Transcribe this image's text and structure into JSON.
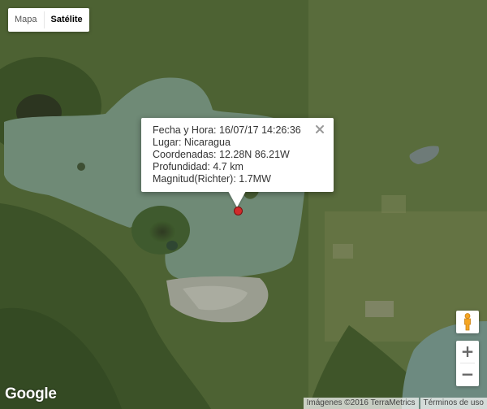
{
  "map_type": {
    "options": [
      "Mapa",
      "Satélite"
    ],
    "selected": "Satélite"
  },
  "info_window": {
    "lines": [
      "Fecha y Hora: 16/07/17 14:26:36",
      "Lugar: Nicaragua",
      "Coordenadas: 12.28N 86.21W",
      "Profundidad: 4.7 km",
      "Magnitud(Richter): 1.7MW"
    ],
    "close_icon": "close-icon"
  },
  "marker": {
    "color": "#d12a2a",
    "icon": "earthquake-marker"
  },
  "controls": {
    "pegman_icon": "street-view-pegman-icon",
    "zoom_in": "+",
    "zoom_out": "−"
  },
  "logo": "Google",
  "attribution": {
    "imagery": "Imágenes ©2016 TerraMetrics",
    "terms": "Términos de uso"
  },
  "colors": {
    "water": "#6f8a76",
    "land": "#4a5e32",
    "urban": "#9a9d90"
  }
}
